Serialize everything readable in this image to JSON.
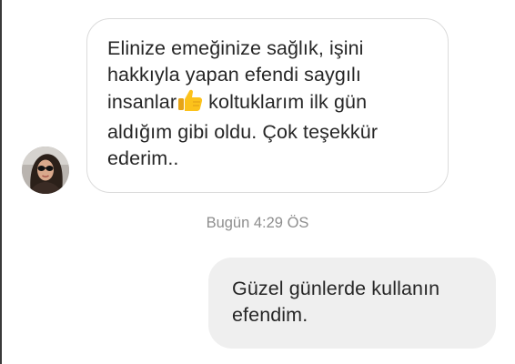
{
  "conversation": {
    "incoming": {
      "lines": [
        "Elinize emeğinize sağlık, işini",
        "hakkıyla yapan efendi saygılı",
        "insanlar",
        "koltuklarım ilk gün",
        "aldığım gibi oldu. Çok teşekkür",
        "ederim.."
      ],
      "emoji": "thumbs-up-icon"
    },
    "timestamp": "Bugün 4:29 ÖS",
    "outgoing": {
      "lines": [
        "Güzel günlerde kullanın",
        "efendim."
      ]
    }
  },
  "colors": {
    "incoming_border": "#dbdbdb",
    "outgoing_background": "#efefef",
    "timestamp": "#8e8e8e",
    "text": "#262626"
  }
}
